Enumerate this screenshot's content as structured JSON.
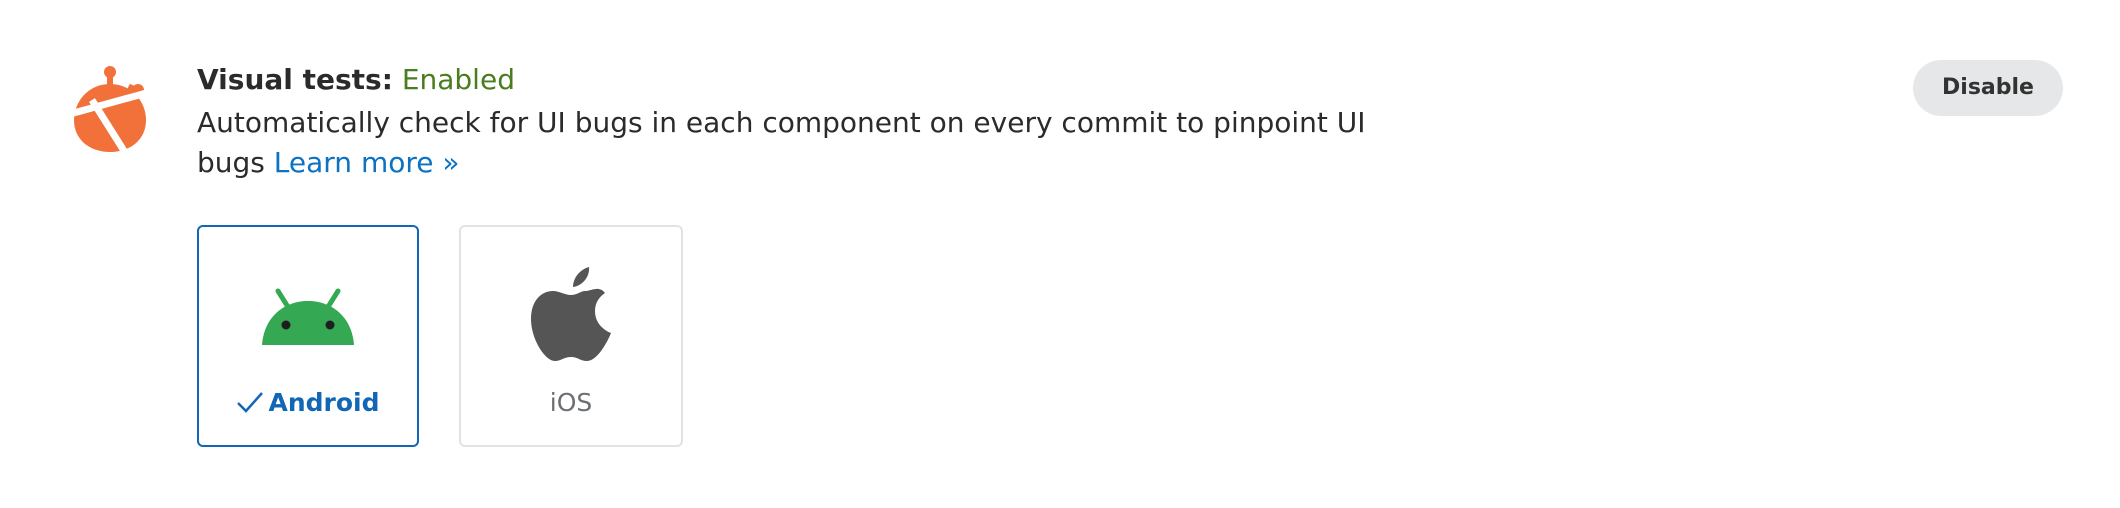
{
  "feature": {
    "label": "Visual tests:",
    "status": "Enabled",
    "description": "Automatically check for UI bugs in each component on every commit to pinpoint UI bugs",
    "learn_more": "Learn more »",
    "icon": "bug-icon"
  },
  "platforms": [
    {
      "label": "Android",
      "icon": "android-icon",
      "selected": true
    },
    {
      "label": "iOS",
      "icon": "apple-icon",
      "selected": false
    }
  ],
  "actions": {
    "disable_label": "Disable"
  },
  "colors": {
    "enabled": "#4a7d1f",
    "link": "#0b72c4",
    "selected_border": "#1167b6",
    "bug_icon": "#f2713b",
    "android": "#34a853",
    "apple": "#555555"
  }
}
